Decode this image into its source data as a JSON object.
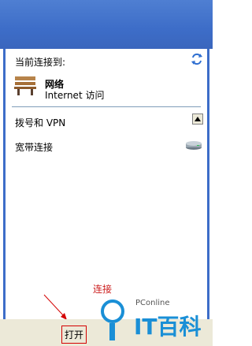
{
  "connection": {
    "current_label": "当前连接到:",
    "network_name": "网络",
    "network_status": "Internet 访问"
  },
  "sections": {
    "dialup_label": "拨号和 VPN",
    "broadband_label": "宽带连接"
  },
  "footer": {
    "open_label": "打开"
  },
  "annotation": {
    "hint_text": "连接"
  },
  "watermark": {
    "small_text": "PConline",
    "big_text": "IT百科"
  },
  "icons": {
    "refresh": "refresh-icon",
    "network": "park-bench-icon",
    "modem": "modem-icon",
    "scroll_up": "scroll-up-icon"
  }
}
